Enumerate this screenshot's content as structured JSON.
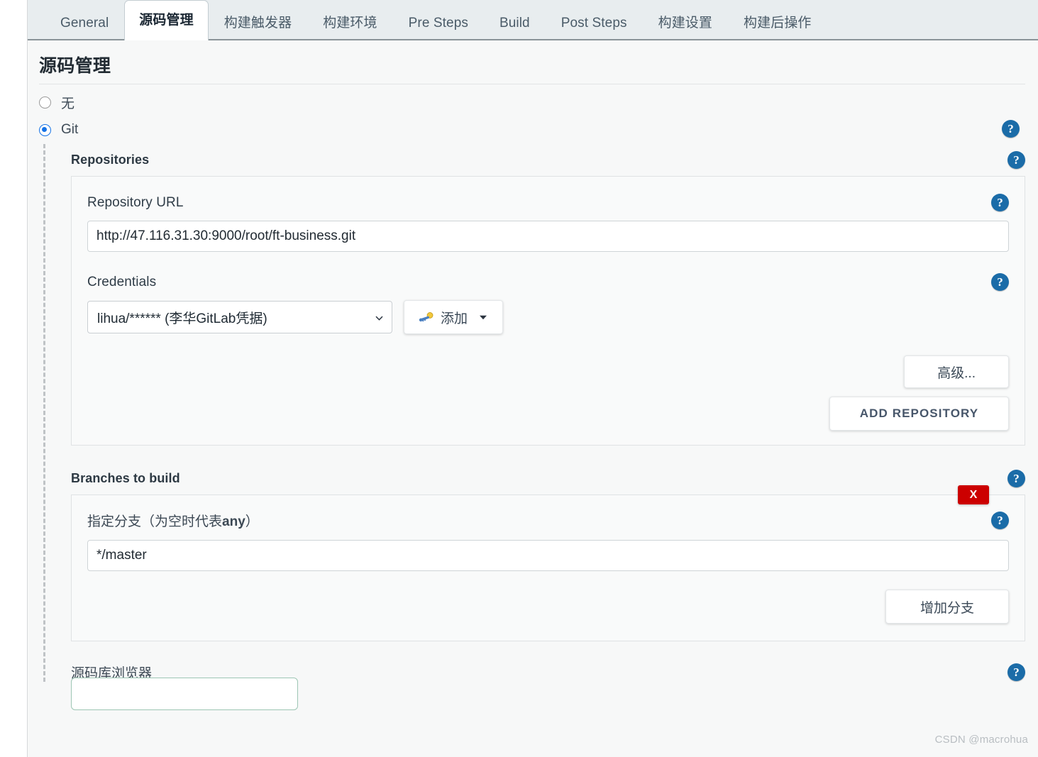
{
  "tabs": [
    {
      "label": "General",
      "active": false
    },
    {
      "label": "源码管理",
      "active": true
    },
    {
      "label": "构建触发器",
      "active": false
    },
    {
      "label": "构建环境",
      "active": false
    },
    {
      "label": "Pre Steps",
      "active": false
    },
    {
      "label": "Build",
      "active": false
    },
    {
      "label": "Post Steps",
      "active": false
    },
    {
      "label": "构建设置",
      "active": false
    },
    {
      "label": "构建后操作",
      "active": false
    }
  ],
  "section": {
    "title": "源码管理"
  },
  "scm_options": [
    {
      "label": "无",
      "checked": false
    },
    {
      "label": "Git",
      "checked": true
    }
  ],
  "repositories": {
    "label": "Repositories",
    "repository_url": {
      "label": "Repository URL",
      "value": "http://47.116.31.30:9000/root/ft-business.git"
    },
    "credentials": {
      "label": "Credentials",
      "selected": "lihua/****** (李华GitLab凭据)",
      "add_button": "添加",
      "key_icon": "key-icon",
      "caret_icon": "caret-down-icon"
    },
    "advanced_button": "高级...",
    "add_repository_button": "ADD REPOSITORY"
  },
  "branches": {
    "label": "Branches to build",
    "delete_badge": "X",
    "branch_spec": {
      "label_prefix": "指定分支（为空时代表",
      "label_bold": "any",
      "label_suffix": "）",
      "value": "*/master"
    },
    "add_branch_button": "增加分支"
  },
  "repository_browser": {
    "label": "源码库浏览器"
  },
  "help_icon_glyph": "?",
  "watermark": "CSDN @macrohua",
  "colors": {
    "accent_blue": "#1673e6",
    "help_blue": "#1b6ca8",
    "danger_red": "#cc0000",
    "tabbar_bg": "#e8edef"
  }
}
